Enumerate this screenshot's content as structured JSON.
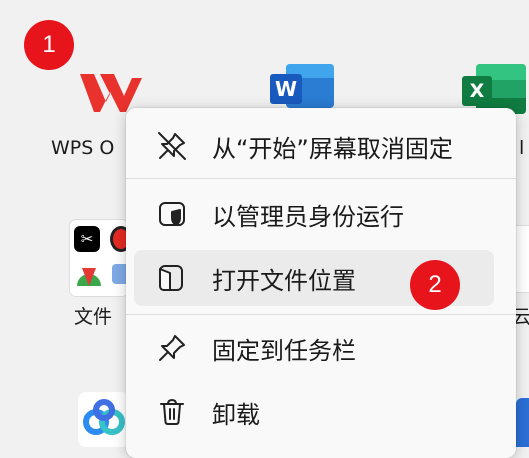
{
  "step_badges": [
    "1",
    "2"
  ],
  "tiles": {
    "wps": {
      "label": "WPS O"
    },
    "word": {
      "letter": "W"
    },
    "excel": {
      "letter": "X",
      "label_fragment": "l"
    },
    "folder": {
      "label": "文件"
    },
    "right_edge_fragment": "云"
  },
  "context_menu": {
    "items": [
      {
        "label": "从“开始”屏幕取消固定",
        "icon": "unpin-icon"
      },
      {
        "label": "以管理员身份运行",
        "icon": "shield-run-icon"
      },
      {
        "label": "打开文件位置",
        "icon": "open-folder-icon"
      },
      {
        "label": "固定到任务栏",
        "icon": "pin-icon"
      },
      {
        "label": "卸载",
        "icon": "trash-icon"
      }
    ]
  },
  "colors": {
    "badge": "#e8141c",
    "wps_red": "#e9322d",
    "word_blue": "#185abd",
    "excel_green": "#107c41"
  }
}
